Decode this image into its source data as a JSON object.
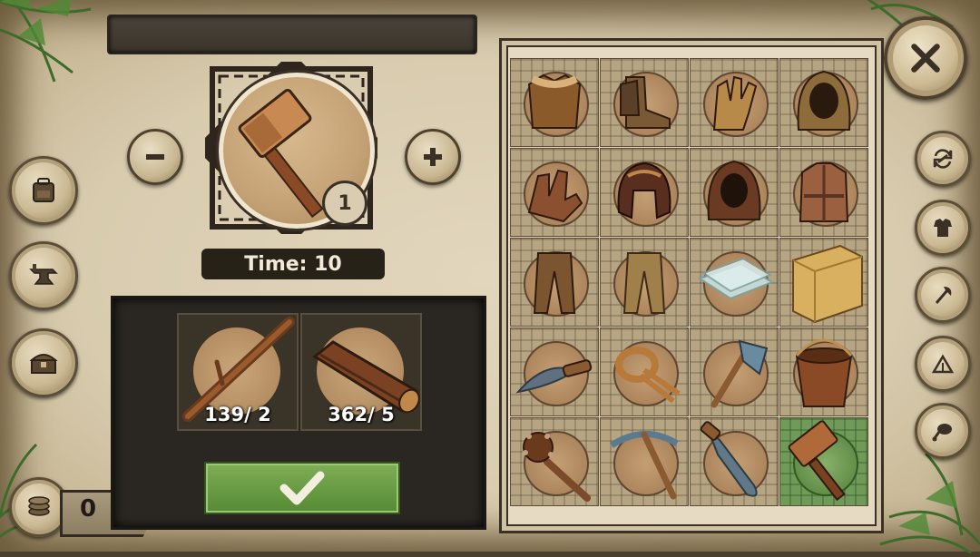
{
  "window": {
    "title": ""
  },
  "craft": {
    "selected_item": "hammer-icon",
    "quantity": "1",
    "time_label": "Time: 10",
    "decrease_icon": "minus-icon",
    "increase_icon": "plus-icon"
  },
  "ingredients": [
    {
      "icon": "stick-icon",
      "count": "139/ 2"
    },
    {
      "icon": "log-icon",
      "count": "362/ 5"
    }
  ],
  "confirm": {
    "icon": "checkmark-icon"
  },
  "currency": {
    "value": "0",
    "icon": "coins-icon"
  },
  "left_menu": [
    {
      "icon": "backpack-icon"
    },
    {
      "icon": "anvil-icon"
    },
    {
      "icon": "chest-icon"
    }
  ],
  "right_menu": [
    {
      "icon": "refresh-icon"
    },
    {
      "icon": "armor-icon"
    },
    {
      "icon": "axe-icon"
    },
    {
      "icon": "tent-icon"
    },
    {
      "icon": "meat-icon"
    }
  ],
  "grid_items": [
    {
      "icon": "fur-armor-icon",
      "color": "#8b5a2b"
    },
    {
      "icon": "boots-icon",
      "color": "#7a5a35"
    },
    {
      "icon": "gloves-icon",
      "color": "#b88a4a"
    },
    {
      "icon": "hood-icon",
      "color": "#8d6b3a"
    },
    {
      "icon": "leather-gloves-icon",
      "color": "#8a5030"
    },
    {
      "icon": "helmet-icon",
      "color": "#5a2e1e"
    },
    {
      "icon": "dark-hood-icon",
      "color": "#6a3a22"
    },
    {
      "icon": "coat-icon",
      "color": "#9a6040"
    },
    {
      "icon": "pants-icon",
      "color": "#7a5530"
    },
    {
      "icon": "light-pants-icon",
      "color": "#a0804a"
    },
    {
      "icon": "glass-icon",
      "color": "#c8e0e0"
    },
    {
      "icon": "sand-block-icon",
      "color": "#d9b060"
    },
    {
      "icon": "knife-icon",
      "color": "#607080"
    },
    {
      "icon": "rope-icon",
      "color": "#b87a3a"
    },
    {
      "icon": "stone-axe-icon",
      "color": "#6a8aa0"
    },
    {
      "icon": "bucket-icon",
      "color": "#8a4a25"
    },
    {
      "icon": "mace-icon",
      "color": "#7a4a2a"
    },
    {
      "icon": "pickaxe-icon",
      "color": "#5a7a90"
    },
    {
      "icon": "machete-icon",
      "color": "#607888"
    },
    {
      "icon": "hammer-icon",
      "color": "#b06a3a"
    }
  ],
  "selected_index": 19
}
